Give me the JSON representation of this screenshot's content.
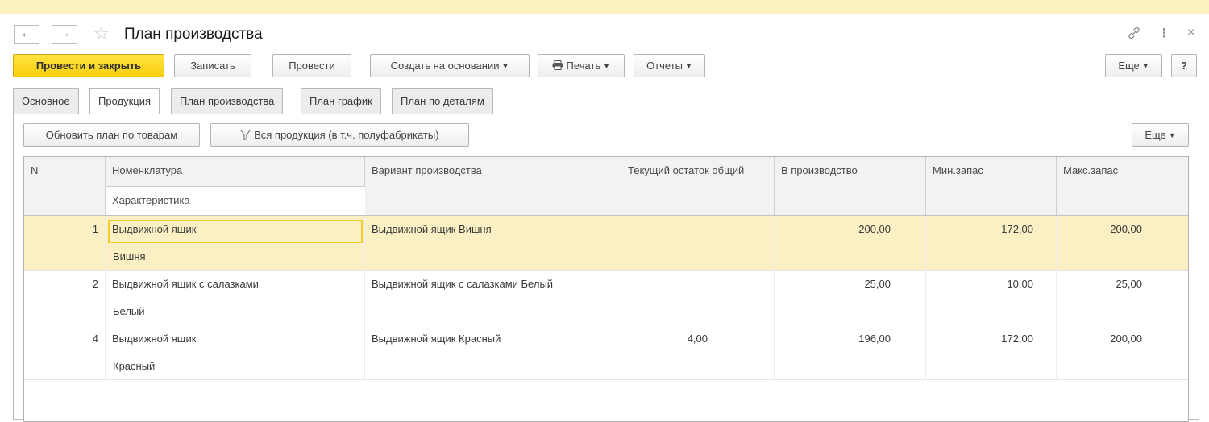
{
  "window": {
    "title": "План производства",
    "back": "←",
    "forward": "→",
    "star": "☆",
    "link_icon": "link-icon",
    "more_icon": "⋮",
    "close_icon": "×"
  },
  "toolbar": {
    "post_close": "Провести и закрыть",
    "save": "Записать",
    "post": "Провести",
    "create_based": "Создать на основании",
    "print": "Печать",
    "reports": "Отчеты",
    "more": "Еще",
    "help": "?"
  },
  "tabs": [
    {
      "label": "Основное"
    },
    {
      "label": "Продукция",
      "active": true
    },
    {
      "label": "План производства"
    },
    {
      "label": "План график"
    },
    {
      "label": "План по деталям"
    }
  ],
  "sub_toolbar": {
    "update_plan": "Обновить план по товарам",
    "filter": "Вся продукция (в т.ч. полуфабрикаты)",
    "more": "Еще"
  },
  "table": {
    "headers": {
      "n": "N",
      "nomenclature": "Номенклатура",
      "characteristic": "Характеристика",
      "variant": "Вариант производства",
      "stock": "Текущий остаток общий",
      "in_production": "В производство",
      "min_stock": "Мин.запас",
      "max_stock": "Макс.запас"
    },
    "rows": [
      {
        "n": "1",
        "nomenclature": "Выдвижной ящик",
        "characteristic": "Вишня",
        "variant": "Выдвижной ящик Вишня",
        "stock": "",
        "in_production": "200,00",
        "min_stock": "172,00",
        "max_stock": "200,00"
      },
      {
        "n": "2",
        "nomenclature": "Выдвижной ящик с салазками",
        "characteristic": "Белый",
        "variant": "Выдвижной ящик с салазками Белый",
        "stock": "",
        "in_production": "25,00",
        "min_stock": "10,00",
        "max_stock": "25,00"
      },
      {
        "n": "4",
        "nomenclature": "Выдвижной ящик",
        "characteristic": "Красный",
        "variant": "Выдвижной ящик Красный",
        "stock": "4,00",
        "in_production": "196,00",
        "min_stock": "172,00",
        "max_stock": "200,00"
      }
    ]
  },
  "colors": {
    "primary_button": "#f8cf0e",
    "selected_row": "#fbf0c3",
    "focus_border": "#f6cc2b",
    "top_strip": "#fbf1c0"
  }
}
